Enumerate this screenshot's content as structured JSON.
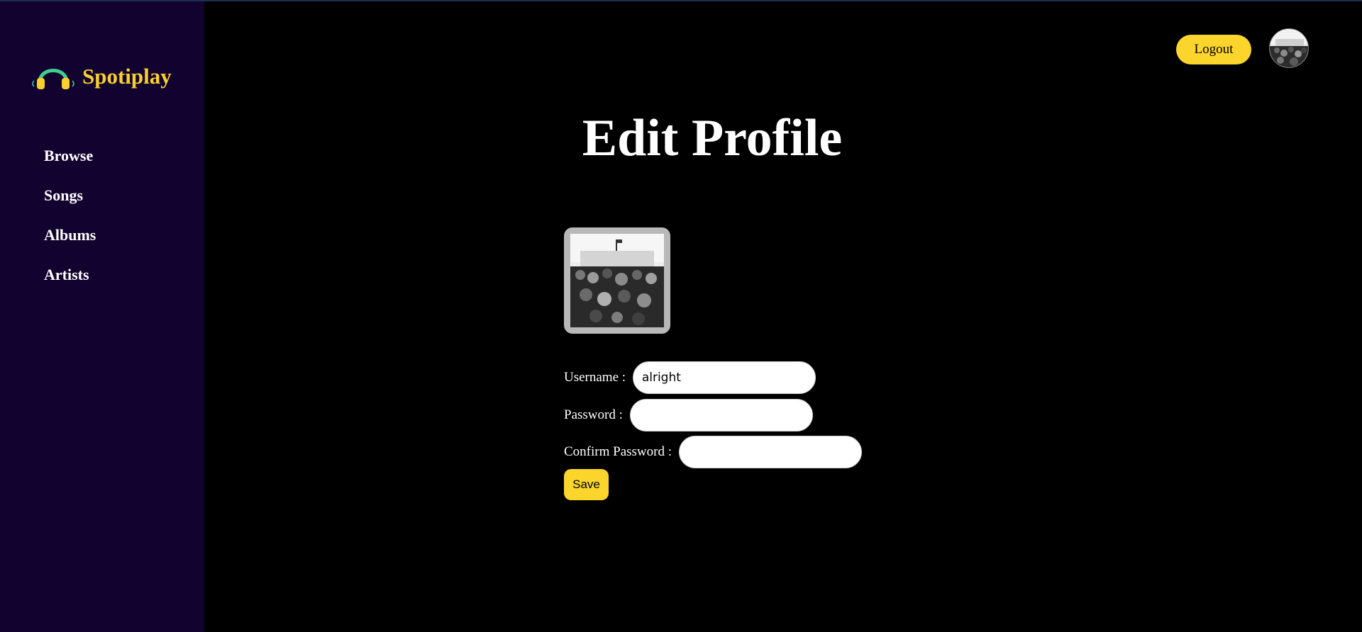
{
  "app": {
    "name": "Spotiplay",
    "brand_color": "#f7d02c",
    "sidebar_bg": "#12022f",
    "logo_icon": "headphones-icon"
  },
  "sidebar": {
    "items": [
      {
        "label": "Browse"
      },
      {
        "label": "Songs"
      },
      {
        "label": "Albums"
      },
      {
        "label": "Artists"
      }
    ]
  },
  "header": {
    "logout_label": "Logout",
    "avatar_icon": "user-avatar"
  },
  "main": {
    "title": "Edit Profile",
    "form": {
      "username_label": "Username : ",
      "username_value": "alright",
      "password_label": "Password : ",
      "password_value": "",
      "confirm_label": "Confirm Password : ",
      "confirm_value": "",
      "save_label": "Save"
    }
  },
  "colors": {
    "button_yellow": "#fcd52c",
    "background": "#000000"
  }
}
